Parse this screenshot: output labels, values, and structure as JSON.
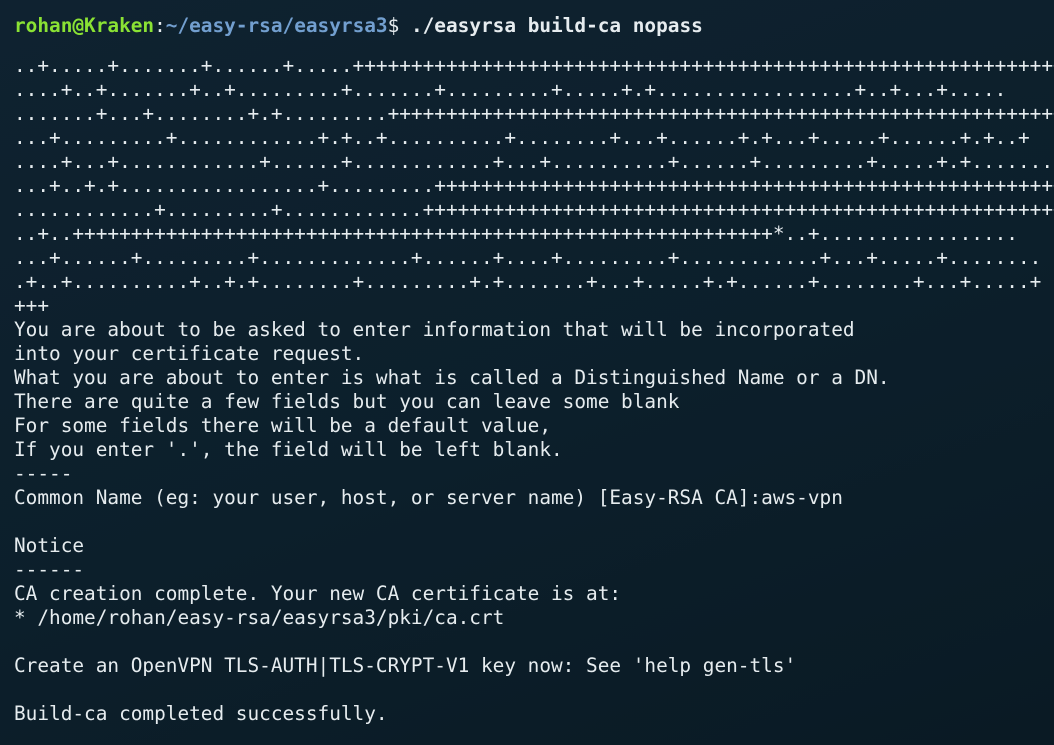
{
  "prompt": {
    "user_host": "rohan@Kraken",
    "separator": ":",
    "path": "~/easy-rsa/easyrsa3",
    "symbol": "$ ",
    "command": "./easyrsa build-ca nopass"
  },
  "output_lines": [
    "..+.....+.......+......+.....+++++++++++++++++++++++++++++++++++++++++++++++++++++++++++++++++++++",
    "....+..+.......+..+.........+.......+.........+.....+.+.................+..+...+.....",
    ".......+...+........+.+.........+++++++++++++++++++++++++++++++++++++++++++++++++++++++++++++++",
    "...+.........+............+.+..+..........+........+...+......+.+...+.....+......+.+..+",
    "....+...+............+......+............+...+..........+......+.........+.....+.+.......",
    "...+..+.+.................+.........++++++++++++++++++++++++++++++++++++++++++++++++++++++++++++++",
    "............+.........+............++++++++++++++++++++++++++++++++++++++++++++++++++++++++++++++",
    "..+..++++++++++++++++++++++++++++++++++++++++++++++++++++++++++++*..+.................",
    "...+......+.........+.............+......+....+.........+............+...+.....+........",
    ".+..+..........+..+.+........+.........+.+.......+...+.....+.+......+........+...+.....+",
    "+++",
    "You are about to be asked to enter information that will be incorporated",
    "into your certificate request.",
    "What you are about to enter is what is called a Distinguished Name or a DN.",
    "There are quite a few fields but you can leave some blank",
    "For some fields there will be a default value,",
    "If you enter '.', the field will be left blank.",
    "-----",
    "Common Name (eg: your user, host, or server name) [Easy-RSA CA]:aws-vpn",
    "",
    "Notice",
    "------",
    "CA creation complete. Your new CA certificate is at:",
    "* /home/rohan/easy-rsa/easyrsa3/pki/ca.crt",
    "",
    "Create an OpenVPN TLS-AUTH|TLS-CRYPT-V1 key now: See 'help gen-tls'",
    "",
    "Build-ca completed successfully."
  ],
  "colors": {
    "background": "#0c1f2b",
    "text": "#e6ecef",
    "user_host": "#8ae234",
    "path": "#729fcf"
  }
}
